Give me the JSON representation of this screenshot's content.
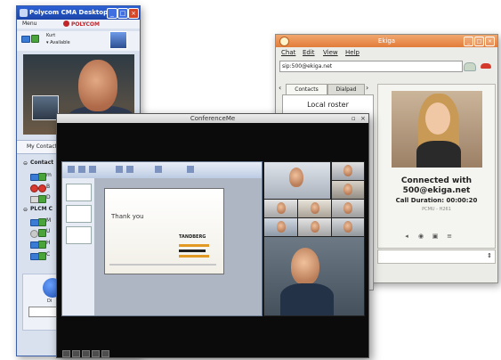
{
  "cma": {
    "title": "Polycom CMA Desktop",
    "menu_label": "Menu",
    "brand": "POLYCOM",
    "user": {
      "name": "Kurt",
      "status": "Available"
    },
    "contacts_header": "My Contact",
    "groups": [
      {
        "label": "Contact",
        "rows": [
          {
            "label": "m",
            "icons": [
              "monitor",
              "phone"
            ]
          },
          {
            "label": "B",
            "icons": [
              "busy",
              "busy"
            ]
          },
          {
            "label": "D",
            "icons": [
              "mail",
              "phone"
            ]
          }
        ]
      },
      {
        "label": "PLCM C",
        "rows": [
          {
            "label": "M",
            "icons": [
              "monitor",
              "phone"
            ]
          },
          {
            "label": "U",
            "icons": [
              "offline",
              "phone"
            ]
          },
          {
            "label": "H",
            "icons": [
              "monitor",
              "phone"
            ]
          },
          {
            "label": "C",
            "icons": [
              "monitor",
              "phone"
            ]
          }
        ]
      }
    ],
    "dial_label": "Di"
  },
  "ekiga": {
    "title": "Ekiga",
    "menu": [
      "Chat",
      "Edit",
      "View",
      "Help"
    ],
    "url": "sip:500@ekiga.net",
    "tabs": [
      "Contacts",
      "Dialpad"
    ],
    "roster_title": "Local roster",
    "connected_line1": "Connected with",
    "connected_line2": "500@ekiga.net",
    "call_duration": "Call Duration: 00:00:20",
    "codec": "PCMU - H261"
  },
  "conf": {
    "title": "ConferenceMe",
    "slide_title": "Thank you",
    "slide_brand": "TANDBERG"
  },
  "colors": {
    "cma_title": "#1b44a8",
    "ekiga_title": "#e27c3a",
    "conf_bg": "#0b0b0b",
    "hangup": "#d33a2c",
    "call_green": "#4aa33b"
  }
}
